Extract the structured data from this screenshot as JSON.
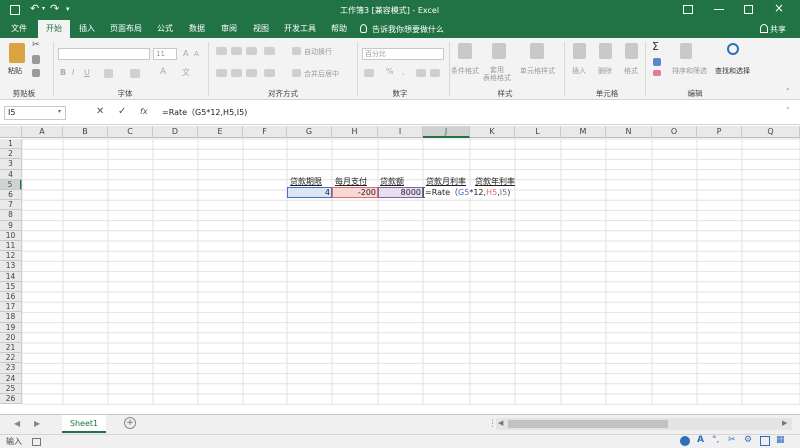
{
  "window": {
    "title": "工作簿3 [兼容模式] - Excel",
    "share_label": "共享"
  },
  "tabs": [
    "文件",
    "开始",
    "插入",
    "页面布局",
    "公式",
    "数据",
    "审阅",
    "视图",
    "开发工具",
    "帮助"
  ],
  "tell_me": "告诉我你想要做什么",
  "ribbon": {
    "clipboard": {
      "paste": "粘贴",
      "label": "剪贴板"
    },
    "font": {
      "name": "",
      "size": "11",
      "label": "字体"
    },
    "alignment": {
      "wrap": "自动换行",
      "merge": "合并后居中",
      "label": "对齐方式"
    },
    "number": {
      "format": "百分比",
      "label": "数字"
    },
    "styles": {
      "conditional": "条件格式",
      "table": "套用\n表格格式",
      "cell": "单元格样式",
      "label": "样式"
    },
    "cells": {
      "insert": "插入",
      "delete": "删除",
      "format": "格式",
      "label": "单元格"
    },
    "editing": {
      "sort": "排序和筛选",
      "find": "查找和选择",
      "label": "编辑"
    }
  },
  "formula_bar": {
    "name_box": "I5",
    "fx": "fx",
    "formula": "=Rate（G5*12,H5,I5)"
  },
  "columns": [
    "A",
    "B",
    "C",
    "D",
    "E",
    "F",
    "G",
    "H",
    "I",
    "J",
    "K",
    "L",
    "M",
    "N",
    "O",
    "P",
    "Q"
  ],
  "rows": [
    "1",
    "2",
    "3",
    "4",
    "5",
    "6",
    "7",
    "8",
    "9",
    "10",
    "11",
    "12",
    "13",
    "14",
    "15",
    "16",
    "17",
    "18",
    "19",
    "20",
    "21",
    "22",
    "23",
    "24",
    "25",
    "26"
  ],
  "cells": {
    "G4": "贷款期限",
    "H4": "每月支付",
    "I4": "贷款额",
    "J4": "贷款月利率",
    "K4": "贷款年利率",
    "G5": "4",
    "H5": "-200",
    "I5": "8000",
    "J5_prefix": "=Rate（",
    "J5_g5": "G5",
    "J5_mid": "*12,",
    "J5_h5": "H5",
    "J5_comma": ",",
    "J5_i5": "I5",
    "J5_close": ")"
  },
  "sheet_tabs": [
    "Sheet1"
  ],
  "status": {
    "mode": "输入"
  },
  "colors": {
    "excel_green": "#217346",
    "ref_blue": "#4472c4",
    "ref_red": "#e46b6b",
    "ref_purple": "#8064a2"
  }
}
